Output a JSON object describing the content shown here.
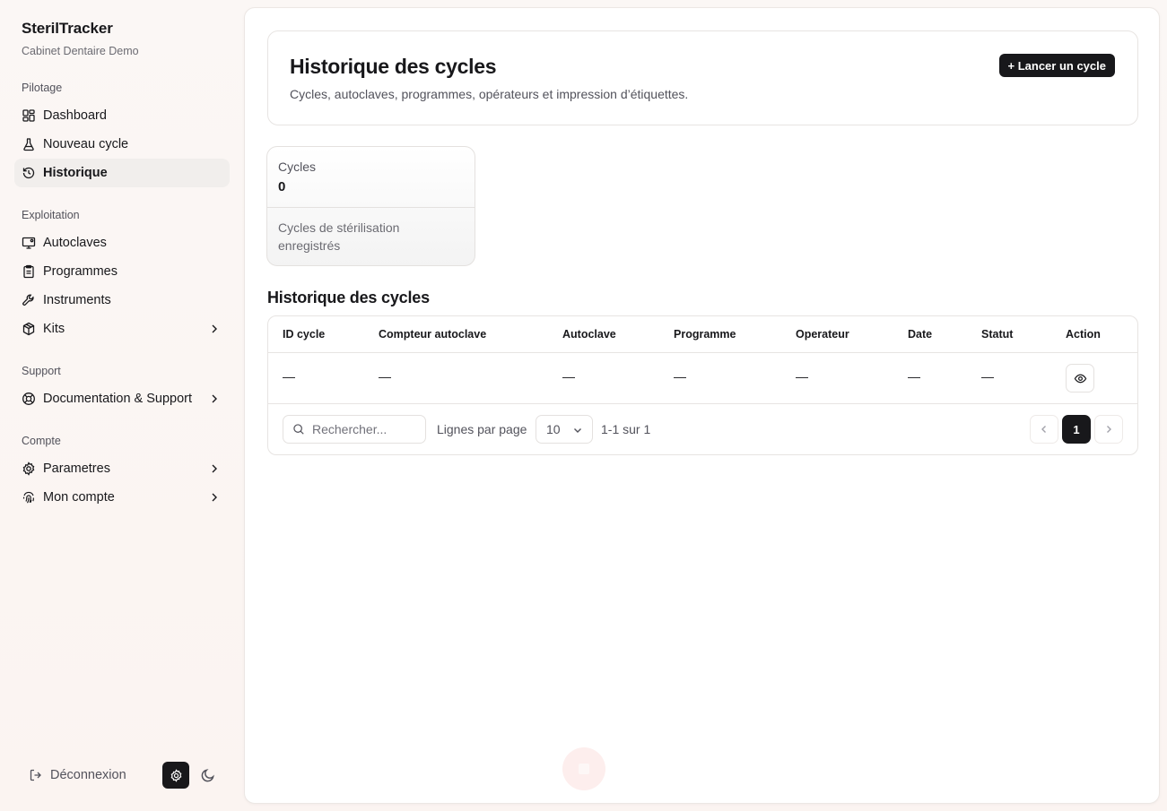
{
  "app": {
    "name": "SterilTracker",
    "subtitle": "Cabinet Dentaire Demo"
  },
  "sidebar": {
    "groups": [
      {
        "label": "Pilotage",
        "items": [
          {
            "label": "Dashboard",
            "icon": "dashboard-icon"
          },
          {
            "label": "Nouveau cycle",
            "icon": "flask-icon"
          },
          {
            "label": "Historique",
            "icon": "history-icon",
            "active": true
          }
        ]
      },
      {
        "label": "Exploitation",
        "items": [
          {
            "label": "Autoclaves",
            "icon": "monitor-icon"
          },
          {
            "label": "Programmes",
            "icon": "clipboard-icon"
          },
          {
            "label": "Instruments",
            "icon": "wrench-icon"
          },
          {
            "label": "Kits",
            "icon": "package-icon",
            "chevron": true
          }
        ]
      },
      {
        "label": "Support",
        "items": [
          {
            "label": "Documentation & Support",
            "icon": "lifebuoy-icon",
            "chevron": true
          }
        ]
      },
      {
        "label": "Compte",
        "items": [
          {
            "label": "Parametres",
            "icon": "gear-icon",
            "chevron": true
          },
          {
            "label": "Mon compte",
            "icon": "fingerprint-icon",
            "chevron": true
          }
        ]
      }
    ],
    "footer": {
      "logout_label": "Déconnexion"
    }
  },
  "header": {
    "title": "Historique des cycles",
    "subtitle": "Cycles, autoclaves, programmes, opérateurs et impression d’étiquettes.",
    "launch_button": "+ Lancer un cycle"
  },
  "stat": {
    "label": "Cycles",
    "value": "0",
    "description": "Cycles de stérilisation enregistrés"
  },
  "table": {
    "title": "Historique des cycles",
    "columns": [
      "ID cycle",
      "Compteur autoclave",
      "Autoclave",
      "Programme",
      "Operateur",
      "Date",
      "Statut",
      "Action"
    ],
    "rows": [
      [
        "—",
        "—",
        "—",
        "—",
        "—",
        "—",
        "—"
      ]
    ],
    "search_placeholder": "Rechercher...",
    "rows_per_page_label": "Lignes par page",
    "rows_per_page_value": "10",
    "range_text": "1-1 sur 1",
    "current_page": "1"
  },
  "colors": {
    "accent": "#18181b",
    "background": "#fbf7f5"
  }
}
